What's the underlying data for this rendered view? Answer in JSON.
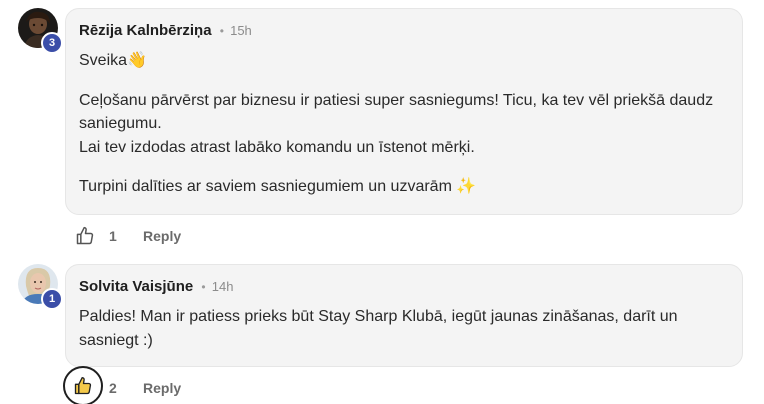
{
  "comments": [
    {
      "author": "Rēzija Kalnbērziņa",
      "separator": "•",
      "time": "15h",
      "level": "3",
      "paragraphs": [
        "Sveika👋",
        "Ceļošanu pārvērst par biznesu ir patiesi super sasniegums! Ticu, ka tev vēl priekšā daudz saniegumu.\nLai tev izdodas atrast labāko komandu un īstenot mērķi.",
        "Turpini dalīties ar saviem sasniegumiem un uzvarām ✨"
      ],
      "likes": "1",
      "liked": false,
      "reply_label": "Reply"
    },
    {
      "author": "Solvita Vaisjūne",
      "separator": "•",
      "time": "14h",
      "level": "1",
      "paragraphs": [
        "Paldies! Man ir patiess prieks būt Stay Sharp Klubā, iegūt jaunas zināšanas, darīt un sasniegt :)"
      ],
      "likes": "2",
      "liked": true,
      "reply_label": "Reply"
    }
  ],
  "colors": {
    "bubble_bg": "#f4f4f4",
    "level_badge": "#3b4ea8",
    "text": "#2a2a2a",
    "muted": "#6b6b6b"
  },
  "icons": {
    "like": "thumbs-up-icon",
    "avatar_1": "avatar-photo",
    "avatar_2": "avatar-photo"
  }
}
